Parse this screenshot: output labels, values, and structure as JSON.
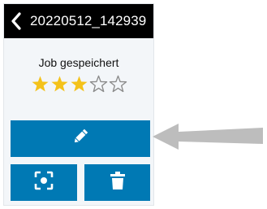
{
  "header": {
    "back_icon": "chevron-left-icon",
    "title": "20220512_142939"
  },
  "job": {
    "status": "Job gespeichert",
    "rating": 3,
    "rating_max": 5
  },
  "actions": {
    "edit_icon": "pencil-icon",
    "scan_icon": "focus-scan-icon",
    "delete_icon": "trash-icon"
  },
  "colors": {
    "titlebar": "#000000",
    "button": "#0079b4",
    "star_filled": "#f4c21a",
    "star_empty": "#8a8a8a",
    "pointer_arrow": "#bdbdbd"
  }
}
